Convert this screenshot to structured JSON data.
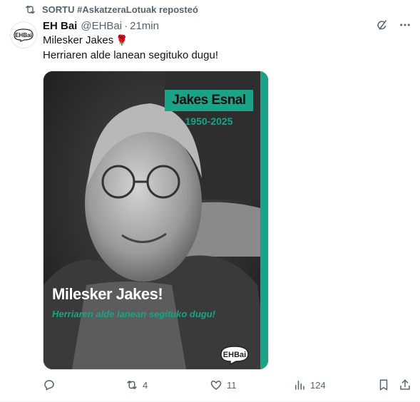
{
  "repost": {
    "text": "SORTU #AskatzeraLotuak reposteó",
    "icon": "repost-icon"
  },
  "author": {
    "name": "EH Bai",
    "handle": "@EHBai",
    "separator": "·",
    "time": "21min",
    "avatar_text": "EHBai"
  },
  "tweet": {
    "line1": "Milesker Jakes",
    "line2": "Herriaren alde lanean segituko dugu!",
    "emoji": "rose"
  },
  "media": {
    "name_box": "Jakes Esnal",
    "years": "1950-2025",
    "headline": "Milesker Jakes!",
    "subline": "Herriaren alde lanean segituko dugu!",
    "logo_text": "EHBai",
    "accent_color": "#1aa387"
  },
  "actions": {
    "reply_count": "",
    "repost_count": "4",
    "like_count": "11",
    "views_count": "124"
  }
}
